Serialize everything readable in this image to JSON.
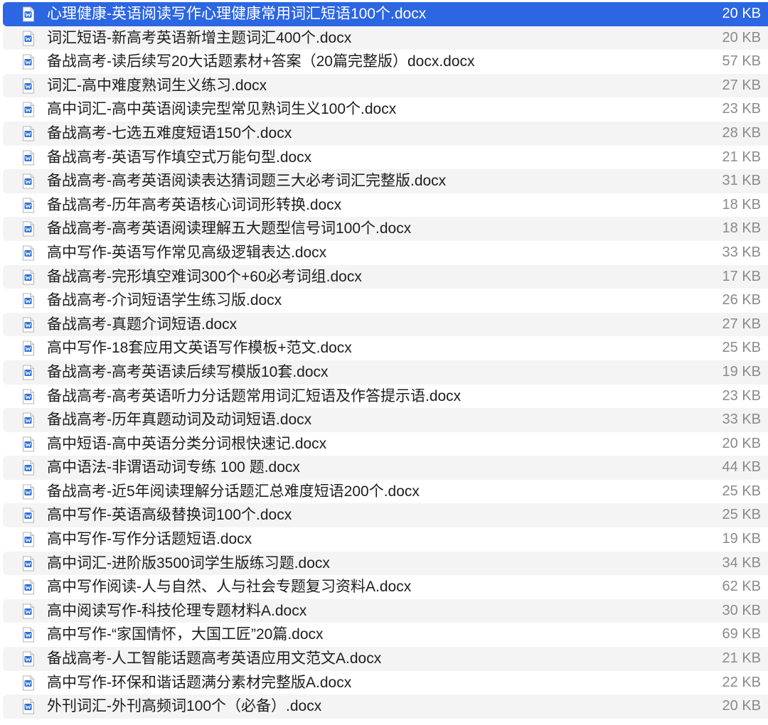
{
  "colors": {
    "selection": "#2c66e2",
    "stripe": "#f4f4f5",
    "text": "#1d1d1f",
    "size_text": "#8a8a8e",
    "icon_accent": "#2b6fd8"
  },
  "icon": "word-document-icon",
  "files": [
    {
      "name": "心理健康-英语阅读写作心理健康常用词汇短语100个.docx",
      "size": "20 KB",
      "selected": true
    },
    {
      "name": "词汇短语-新高考英语新增主题词汇400个.docx",
      "size": "20 KB"
    },
    {
      "name": "备战高考-读后续写20大话题素材+答案（20篇完整版）docx.docx",
      "size": "57 KB"
    },
    {
      "name": "词汇-高中难度熟词生义练习.docx",
      "size": "27 KB"
    },
    {
      "name": "高中词汇-高中英语阅读完型常见熟词生义100个.docx",
      "size": "23 KB"
    },
    {
      "name": "备战高考-七选五难度短语150个.docx",
      "size": "28 KB"
    },
    {
      "name": "备战高考-英语写作填空式万能句型.docx",
      "size": "21 KB"
    },
    {
      "name": "备战高考-高考英语阅读表达猜词题三大必考词汇完整版.docx",
      "size": "31 KB"
    },
    {
      "name": "备战高考-历年高考英语核心词词形转换.docx",
      "size": "18 KB"
    },
    {
      "name": "备战高考-高考英语阅读理解五大题型信号词100个.docx",
      "size": "18 KB"
    },
    {
      "name": "高中写作-英语写作常见高级逻辑表达.docx",
      "size": "33 KB"
    },
    {
      "name": "备战高考-完形填空难词300个+60必考词组.docx",
      "size": "17 KB"
    },
    {
      "name": "备战高考-介词短语学生练习版.docx",
      "size": "26 KB"
    },
    {
      "name": "备战高考-真题介词短语.docx",
      "size": "27 KB"
    },
    {
      "name": "高中写作-18套应用文英语写作模板+范文.docx",
      "size": "25 KB"
    },
    {
      "name": "备战高考-高考英语读后续写模版10套.docx",
      "size": "19 KB"
    },
    {
      "name": "备战高考-高考英语听力分话题常用词汇短语及作答提示语.docx",
      "size": "23 KB"
    },
    {
      "name": "备战高考-历年真题动词及动词短语.docx",
      "size": "33 KB"
    },
    {
      "name": "高中短语-高中英语分类分词根快速记.docx",
      "size": "20 KB"
    },
    {
      "name": "高中语法-非谓语动词专练 100 题.docx",
      "size": "44 KB"
    },
    {
      "name": "备战高考-近5年阅读理解分话题汇总难度短语200个.docx",
      "size": "25 KB"
    },
    {
      "name": "高中写作-英语高级替换词100个.docx",
      "size": "25 KB"
    },
    {
      "name": "高中写作-写作分话题短语.docx",
      "size": "19 KB"
    },
    {
      "name": "高中词汇-进阶版3500词学生版练习题.docx",
      "size": "34 KB"
    },
    {
      "name": "高中写作阅读-人与自然、人与社会专题复习资料A.docx",
      "size": "62 KB"
    },
    {
      "name": "高中阅读写作-科技伦理专题材料A.docx",
      "size": "30 KB"
    },
    {
      "name": "高中写作-“家国情怀，大国工匠”20篇.docx",
      "size": "69 KB"
    },
    {
      "name": "备战高考-人工智能话题高考英语应用文范文A.docx",
      "size": "21 KB"
    },
    {
      "name": "高中写作-环保和谐话题满分素材完整版A.docx",
      "size": "22 KB"
    },
    {
      "name": "外刊词汇-外刊高频词100个（必备）.docx",
      "size": "20 KB"
    }
  ]
}
